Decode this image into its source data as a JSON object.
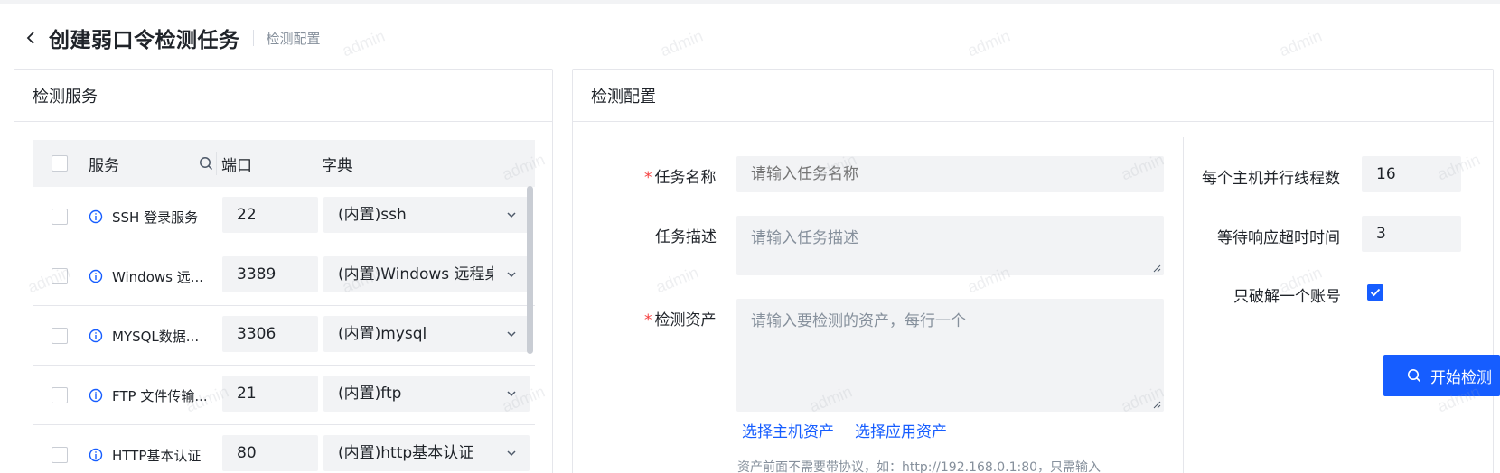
{
  "header": {
    "title": "创建弱口令检测任务",
    "subtitle": "检测配置"
  },
  "left_panel": {
    "title": "检测服务",
    "columns": {
      "service": "服务",
      "port": "端口",
      "dict": "字典"
    },
    "rows": [
      {
        "service": "SSH 登录服务",
        "port": "22",
        "dict": "(内置)ssh"
      },
      {
        "service": "Windows 远...",
        "port": "3389",
        "dict": "(内置)Windows 远程桌"
      },
      {
        "service": "MYSQL数据...",
        "port": "3306",
        "dict": "(内置)mysql"
      },
      {
        "service": "FTP 文件传输...",
        "port": "21",
        "dict": "(内置)ftp"
      },
      {
        "service": "HTTP基本认证",
        "port": "80",
        "dict": "(内置)http基本认证"
      }
    ]
  },
  "right_panel": {
    "title": "检测配置",
    "task_name": {
      "label": "任务名称",
      "placeholder": "请输入任务名称"
    },
    "task_desc": {
      "label": "任务描述",
      "placeholder": "请输入任务描述"
    },
    "assets": {
      "label": "检测资产",
      "placeholder": "请输入要检测的资产，每行一个"
    },
    "links": {
      "host_assets": "选择主机资产",
      "app_assets": "选择应用资产"
    },
    "hint": "资产前面不需要带协议，如：http://192.168.0.1:80，只需输入",
    "threads": {
      "label": "每个主机并行线程数",
      "value": "16"
    },
    "timeout": {
      "label": "等待响应超时时间",
      "value": "3"
    },
    "single_account": {
      "label": "只破解一个账号",
      "checked": true
    },
    "start_button": "开始检测"
  },
  "watermark": "admin",
  "colors": {
    "primary": "#165dff",
    "required": "#f53f3f",
    "field_bg": "#f2f3f5"
  }
}
